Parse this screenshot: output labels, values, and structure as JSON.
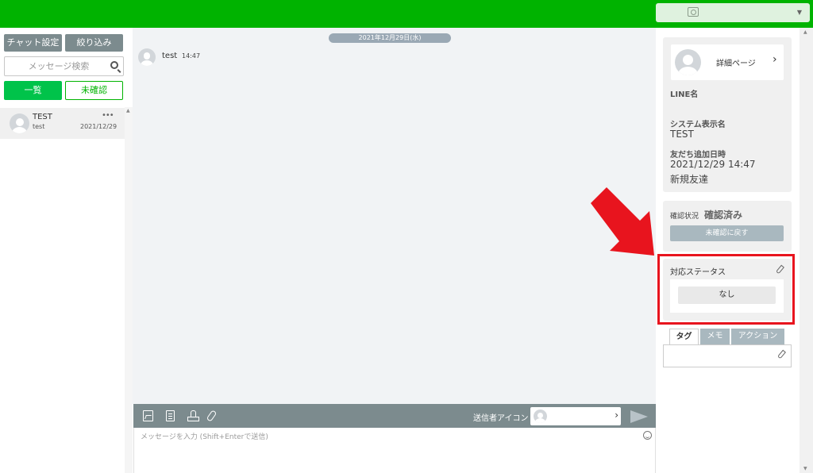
{
  "left": {
    "buttons": {
      "chat_settings": "チャット設定",
      "filter": "絞り込み"
    },
    "search": {
      "placeholder": "メッセージ検索",
      "value": ""
    },
    "tabs": {
      "all": "一覧",
      "unread": "未確認"
    },
    "contacts": [
      {
        "name": "TEST",
        "subtitle": "test",
        "date": "2021/12/29",
        "more": "•••"
      }
    ]
  },
  "chat": {
    "date_separator": "2021年12月29日(水)",
    "messages": [
      {
        "sender": "test",
        "time": "14:47"
      }
    ],
    "composer": {
      "tools": [
        "image-icon",
        "document-icon",
        "stamp-icon",
        "attachment-icon"
      ],
      "sender_icon_label": "送信者アイコン",
      "placeholder": "メッセージを入力 (Shift+Enterで送信)",
      "send_icon": "send-icon",
      "chevron": "›"
    }
  },
  "right": {
    "detail": {
      "label": "詳細ページ",
      "chevron": "›"
    },
    "line_name_label": "LINE名",
    "line_name_value": "",
    "system_name_label": "システム表示名",
    "system_name_value": "TEST",
    "friend_added_label": "友だち追加日時",
    "friend_added_value": "2021/12/29 14:47",
    "friend_type": "新規友達",
    "confirm": {
      "label": "確認状況",
      "value": "確認済み",
      "revert_button": "未確認に戻す"
    },
    "status": {
      "title": "対応ステータス",
      "value": "なし"
    },
    "tabs": {
      "tag": "タグ",
      "memo": "メモ",
      "action": "アクション"
    }
  },
  "colors": {
    "brand_green": "#00b300",
    "accent_green": "#00c34a",
    "toolbar_gray": "#7c8b8e",
    "highlight_red": "#e8141e"
  }
}
